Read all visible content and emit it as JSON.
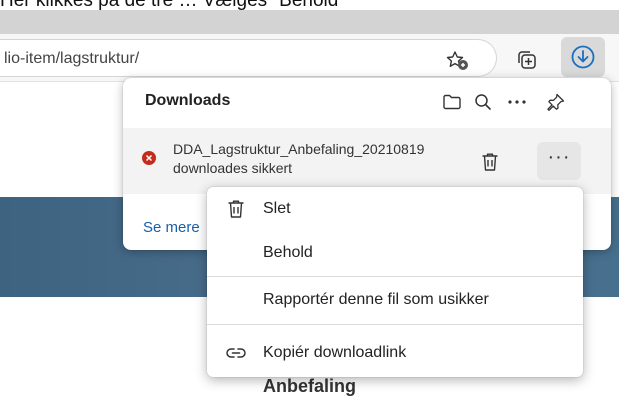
{
  "caption": "Her klikkes på de tre … Vælges \"Behold\"",
  "browser": {
    "url": "lio-item/lagstruktur/",
    "toolbar_icons": [
      "favorite-star-icon",
      "collections-icon",
      "download-icon"
    ]
  },
  "downloads_panel": {
    "title": "Downloads",
    "header_icons": [
      "folder-icon",
      "search-icon",
      "more-icon",
      "pin-icon"
    ],
    "item": {
      "filename": "DDA_Lagstruktur_Anbefaling_20210819",
      "status": "downloades sikkert",
      "status_icon": "error-icon",
      "more_label": "···"
    },
    "see_more": "Se mere"
  },
  "context_menu": {
    "items": [
      {
        "label": "Slet",
        "icon": "trash-icon"
      },
      {
        "label": "Behold",
        "icon": ""
      },
      {
        "label": "Rapportér denne fil som usikker",
        "icon": ""
      },
      {
        "label": "Kopiér downloadlink",
        "icon": "link-icon"
      }
    ]
  },
  "page": {
    "heading": "Anbefaling"
  },
  "colors": {
    "error": "#c42b1c",
    "link": "#1a5ea8",
    "accent_icon": "#1a6fbf",
    "banner": "#4a6f8d"
  }
}
